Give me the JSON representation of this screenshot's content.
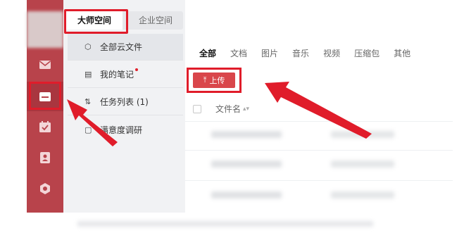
{
  "colors": {
    "rail": "#b8434b",
    "accent": "#d9464b",
    "annotation": "#e01c2a"
  },
  "rail": {
    "icons": [
      "mail-icon",
      "folder-icon",
      "calendar-check-icon",
      "contact-icon",
      "settings-icon"
    ]
  },
  "nav": {
    "tabs": [
      {
        "label": "大师空间"
      },
      {
        "label": "企业空间"
      }
    ],
    "items": [
      {
        "label": "全部云文件",
        "icon": "cube-icon"
      },
      {
        "label": "我的笔记",
        "icon": "note-icon"
      },
      {
        "label": "任务列表 (1)",
        "icon": "task-icon"
      },
      {
        "label": "满意度调研",
        "icon": "survey-icon"
      }
    ]
  },
  "main": {
    "filters": [
      "全部",
      "文档",
      "图片",
      "音乐",
      "视频",
      "压缩包",
      "其他"
    ],
    "upload_label": "上传",
    "column_name": "文件名"
  }
}
